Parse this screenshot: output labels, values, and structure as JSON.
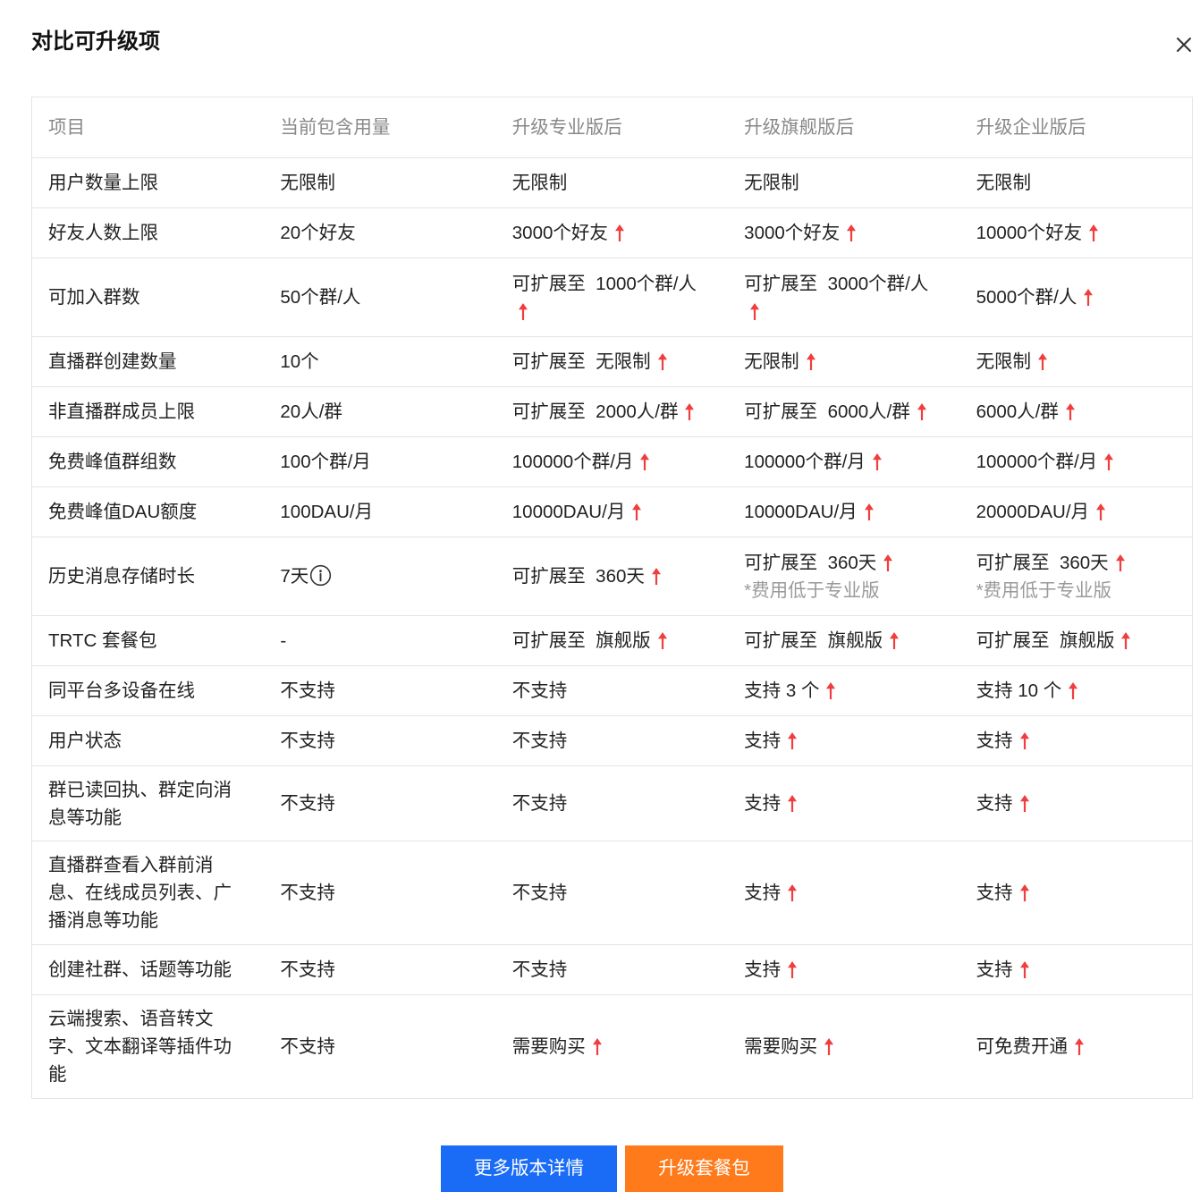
{
  "dialog": {
    "title": "对比可升级项",
    "close_icon": "close-icon"
  },
  "table": {
    "headers": [
      "项目",
      "当前包含用量",
      "升级专业版后",
      "升级旗舰版后",
      "升级企业版后"
    ],
    "rows": [
      {
        "item": "用户数量上限",
        "cells": [
          {
            "text": "无限制"
          },
          {
            "text": "无限制"
          },
          {
            "text": "无限制"
          },
          {
            "text": "无限制"
          }
        ]
      },
      {
        "item": "好友人数上限",
        "cells": [
          {
            "text": "20个好友"
          },
          {
            "text": "3000个好友",
            "icon": "up-arrow-icon"
          },
          {
            "text": "3000个好友",
            "icon": "up-arrow-icon"
          },
          {
            "text": "10000个好友",
            "icon": "up-arrow-icon"
          }
        ]
      },
      {
        "item": "可加入群数",
        "cells": [
          {
            "text": "50个群/人"
          },
          {
            "text": "可扩展至  1000个群/人",
            "icon": "up-arrow-icon"
          },
          {
            "text": "可扩展至  3000个群/人",
            "icon": "up-arrow-icon"
          },
          {
            "text": "5000个群/人",
            "icon": "up-arrow-icon"
          }
        ]
      },
      {
        "item": "直播群创建数量",
        "cells": [
          {
            "text": "10个"
          },
          {
            "text": "可扩展至  无限制",
            "icon": "up-arrow-icon"
          },
          {
            "text": "无限制",
            "icon": "up-arrow-icon"
          },
          {
            "text": "无限制",
            "icon": "up-arrow-icon"
          }
        ]
      },
      {
        "item": "非直播群成员上限",
        "cells": [
          {
            "text": "20人/群"
          },
          {
            "text": "可扩展至  2000人/群",
            "icon": "up-arrow-icon"
          },
          {
            "text": "可扩展至  6000人/群",
            "icon": "up-arrow-icon"
          },
          {
            "text": "6000人/群",
            "icon": "up-arrow-icon"
          }
        ]
      },
      {
        "item": "免费峰值群组数",
        "cells": [
          {
            "text": "100个群/月"
          },
          {
            "text": "100000个群/月",
            "icon": "up-arrow-icon"
          },
          {
            "text": "100000个群/月",
            "icon": "up-arrow-icon"
          },
          {
            "text": "100000个群/月",
            "icon": "up-arrow-icon"
          }
        ]
      },
      {
        "item": "免费峰值DAU额度",
        "cells": [
          {
            "text": "100DAU/月"
          },
          {
            "text": "10000DAU/月",
            "icon": "up-arrow-icon"
          },
          {
            "text": "10000DAU/月",
            "icon": "up-arrow-icon"
          },
          {
            "text": "20000DAU/月",
            "icon": "up-arrow-icon"
          }
        ]
      },
      {
        "item": "历史消息存储时长",
        "cells": [
          {
            "text": "7天",
            "icon": "info-icon"
          },
          {
            "text": "可扩展至  360天",
            "icon": "up-arrow-icon"
          },
          {
            "text": "可扩展至  360天",
            "icon": "up-arrow-icon",
            "note": "*费用低于专业版"
          },
          {
            "text": "可扩展至  360天",
            "icon": "up-arrow-icon",
            "note": "*费用低于专业版"
          }
        ]
      },
      {
        "item": "TRTC 套餐包",
        "cells": [
          {
            "text": "-"
          },
          {
            "text": "可扩展至  旗舰版",
            "icon": "up-arrow-icon"
          },
          {
            "text": "可扩展至  旗舰版",
            "icon": "up-arrow-icon"
          },
          {
            "text": "可扩展至  旗舰版",
            "icon": "up-arrow-icon"
          }
        ]
      },
      {
        "item": "同平台多设备在线",
        "cells": [
          {
            "text": "不支持"
          },
          {
            "text": "不支持"
          },
          {
            "text": "支持 3 个",
            "icon": "up-arrow-icon"
          },
          {
            "text": "支持 10 个",
            "icon": "up-arrow-icon"
          }
        ]
      },
      {
        "item": "用户状态",
        "cells": [
          {
            "text": "不支持"
          },
          {
            "text": "不支持"
          },
          {
            "text": "支持",
            "icon": "up-arrow-icon"
          },
          {
            "text": "支持",
            "icon": "up-arrow-icon"
          }
        ]
      },
      {
        "item": "群已读回执、群定向消息等功能",
        "cells": [
          {
            "text": "不支持"
          },
          {
            "text": "不支持"
          },
          {
            "text": "支持",
            "icon": "up-arrow-icon"
          },
          {
            "text": "支持",
            "icon": "up-arrow-icon"
          }
        ]
      },
      {
        "item": "直播群查看入群前消息、在线成员列表、广播消息等功能",
        "cells": [
          {
            "text": "不支持"
          },
          {
            "text": "不支持"
          },
          {
            "text": "支持",
            "icon": "up-arrow-icon"
          },
          {
            "text": "支持",
            "icon": "up-arrow-icon"
          }
        ]
      },
      {
        "item": "创建社群、话题等功能",
        "cells": [
          {
            "text": "不支持"
          },
          {
            "text": "不支持"
          },
          {
            "text": "支持",
            "icon": "up-arrow-icon"
          },
          {
            "text": "支持",
            "icon": "up-arrow-icon"
          }
        ]
      },
      {
        "item": "云端搜索、语音转文字、文本翻译等插件功能",
        "cells": [
          {
            "text": "不支持"
          },
          {
            "text": "需要购买",
            "icon": "up-arrow-icon"
          },
          {
            "text": "需要购买",
            "icon": "up-arrow-icon"
          },
          {
            "text": "可免费开通",
            "icon": "up-arrow-icon"
          }
        ]
      }
    ]
  },
  "buttons": {
    "more_details": "更多版本详情",
    "upgrade": "升级套餐包"
  },
  "colors": {
    "primary_button": "#1a6cf6",
    "upgrade_button": "#ff7a1a",
    "up_arrow": "#f03d3d"
  }
}
